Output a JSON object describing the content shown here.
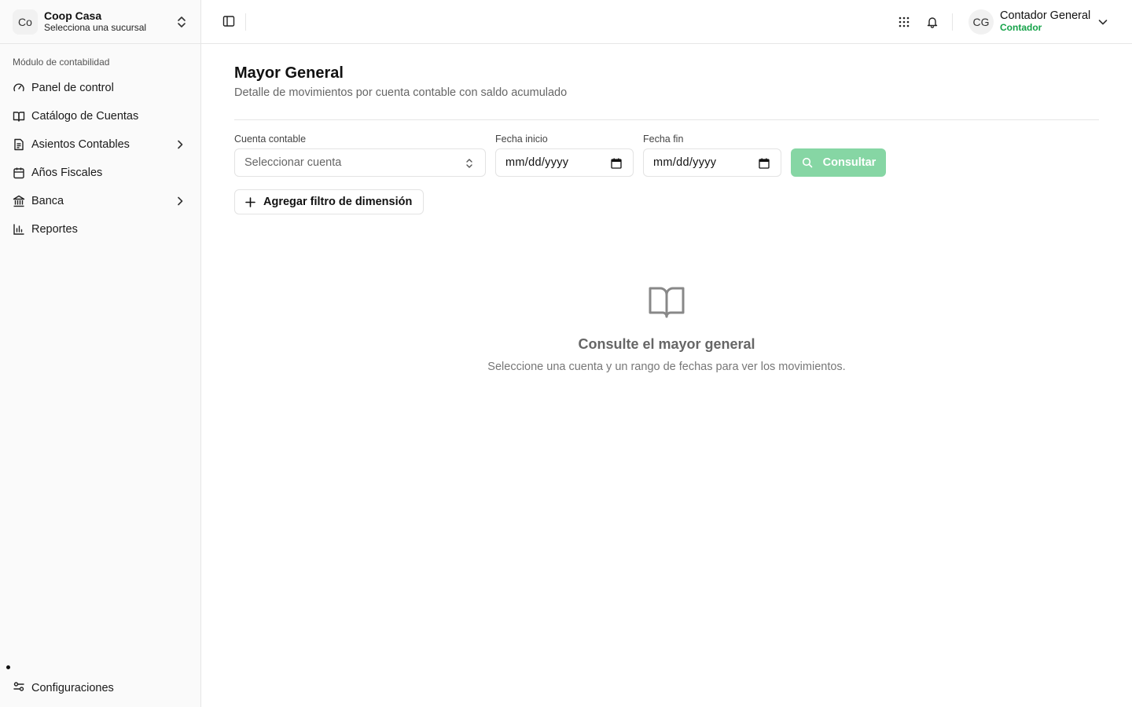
{
  "org": {
    "avatar_text": "Co",
    "name": "Coop Casa",
    "subtitle": "Selecciona una sucursal"
  },
  "sidebar": {
    "section_label": "Módulo de contabilidad",
    "items": [
      {
        "label": "Panel de control",
        "icon": "gauge-icon",
        "has_submenu": false
      },
      {
        "label": "Catálogo de Cuentas",
        "icon": "book-icon",
        "has_submenu": false
      },
      {
        "label": "Asientos Contables",
        "icon": "file-text-icon",
        "has_submenu": true
      },
      {
        "label": "Años Fiscales",
        "icon": "calendar-icon",
        "has_submenu": false
      },
      {
        "label": "Banca",
        "icon": "bank-icon",
        "has_submenu": true
      },
      {
        "label": "Reportes",
        "icon": "bar-chart-icon",
        "has_submenu": false
      }
    ],
    "settings_label": "Configuraciones"
  },
  "header": {
    "user": {
      "initials": "CG",
      "name": "Contador General",
      "role": "Contador"
    }
  },
  "page": {
    "title": "Mayor General",
    "subtitle": "Detalle de movimientos por cuenta contable con saldo acumulado"
  },
  "filters": {
    "account_label": "Cuenta contable",
    "account_placeholder": "Seleccionar cuenta",
    "start_label": "Fecha inicio",
    "start_value": "mm/dd/yyyy",
    "end_label": "Fecha fin",
    "end_value": "mm/dd/yyyy",
    "submit_label": "Consultar",
    "add_dimension_label": "Agregar filtro de dimensión"
  },
  "empty_state": {
    "title": "Consulte el mayor general",
    "message": "Seleccione una cuenta y un rango de fechas para ver los movimientos."
  },
  "colors": {
    "accent": "#16a34a",
    "button_disabled": "#86d6a4",
    "sidebar_bg": "#fafafa",
    "border": "#e6e6e6"
  }
}
